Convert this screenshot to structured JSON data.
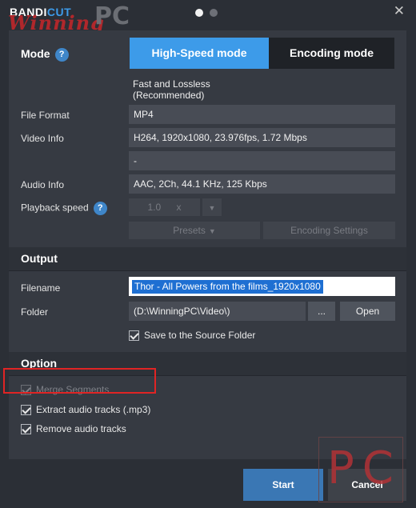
{
  "app": {
    "logo_bandi": "BANDI",
    "logo_cut": "CUT",
    "watermark_script": "Winning",
    "watermark_pc": "PC",
    "close_glyph": "✕"
  },
  "mode": {
    "label": "Mode",
    "help": "?",
    "high_speed_label": "High-Speed mode",
    "encoding_label": "Encoding mode",
    "description": "Fast and Lossless (Recommended)"
  },
  "fields": {
    "file_format_label": "File Format",
    "file_format_value": "MP4",
    "video_info_label": "Video Info",
    "video_info_value": "H264, 1920x1080, 23.976fps, 1.72 Mbps",
    "video_extra_value": "-",
    "audio_info_label": "Audio Info",
    "audio_info_value": "AAC, 2Ch, 44.1 KHz, 125 Kbps",
    "playback_speed_label": "Playback speed",
    "playback_speed_help": "?",
    "playback_speed_value": "1.0",
    "playback_speed_unit": "x",
    "presets_label": "Presets",
    "encoding_settings_label": "Encoding Settings"
  },
  "output": {
    "title": "Output",
    "filename_label": "Filename",
    "filename_value": "Thor - All Powers from the films_1920x1080",
    "folder_label": "Folder",
    "folder_value": "(D:\\WinningPC\\Video\\)",
    "browse_label": "...",
    "open_label": "Open",
    "save_source_label": "Save to the Source Folder"
  },
  "option": {
    "title": "Option",
    "merge_segments_label": "Merge Segments",
    "extract_audio_label": "Extract audio tracks (.mp3)",
    "remove_audio_label": "Remove audio tracks"
  },
  "footer": {
    "start_label": "Start",
    "cancel_label": "Cancel",
    "pc_watermark": "PC"
  },
  "colors": {
    "accent": "#3d9be9",
    "highlight_box": "#e02424",
    "background": "#2b2f36"
  }
}
